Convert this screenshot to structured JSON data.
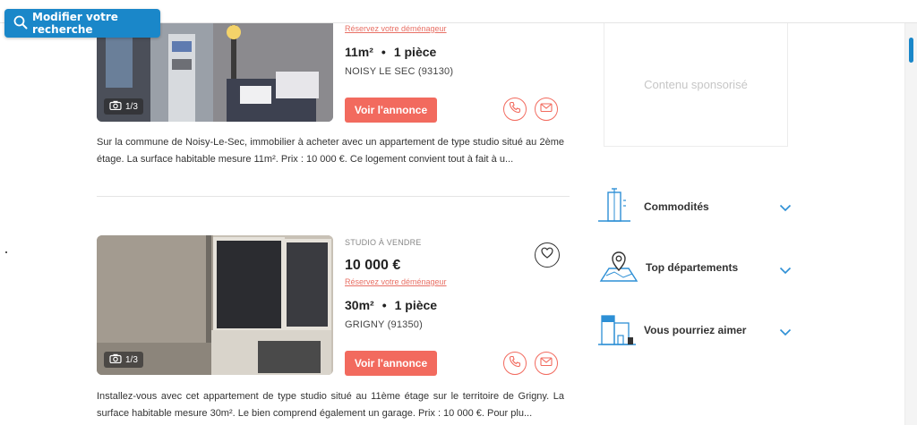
{
  "search": {
    "label": "Modifier votre recherche"
  },
  "listings": [
    {
      "type_label": "",
      "price": "",
      "mover_link": "Réservez votre déménageur",
      "surface": "11m²",
      "rooms": "1 pièce",
      "city": "NOISY LE SEC (93130)",
      "photo_counter": "1/3",
      "cta": "Voir l'annonce",
      "description": "Sur la commune de Noisy-Le-Sec, immobilier à acheter avec un appartement de type studio situé au 2ème étage. La surface habitable mesure 11m². Prix : 10 000 €. Ce logement convient tout à fait à u..."
    },
    {
      "type_label": "STUDIO À VENDRE",
      "price": "10 000 €",
      "mover_link": "Réservez votre déménageur",
      "surface": "30m²",
      "rooms": "1 pièce",
      "city": "GRIGNY (91350)",
      "photo_counter": "1/3",
      "cta": "Voir l'annonce",
      "description": "Installez-vous avec cet appartement de type studio situé au 11ème étage sur le territoire de Grigny. La surface habitable mesure 30m². Le bien comprend également un garage. Prix : 10 000 €. Pour plu..."
    }
  ],
  "sidebar": {
    "sponsored": "Contenu sponsorisé",
    "items": [
      {
        "label": "Commodités",
        "icon": "building-icon"
      },
      {
        "label": "Top départements",
        "icon": "map-pin-icon"
      },
      {
        "label": "Vous pourriez aimer",
        "icon": "house-icon"
      }
    ]
  },
  "colors": {
    "primary": "#1a87c9",
    "accent": "#f26a5e",
    "icon_blue": "#2d8fd5"
  }
}
